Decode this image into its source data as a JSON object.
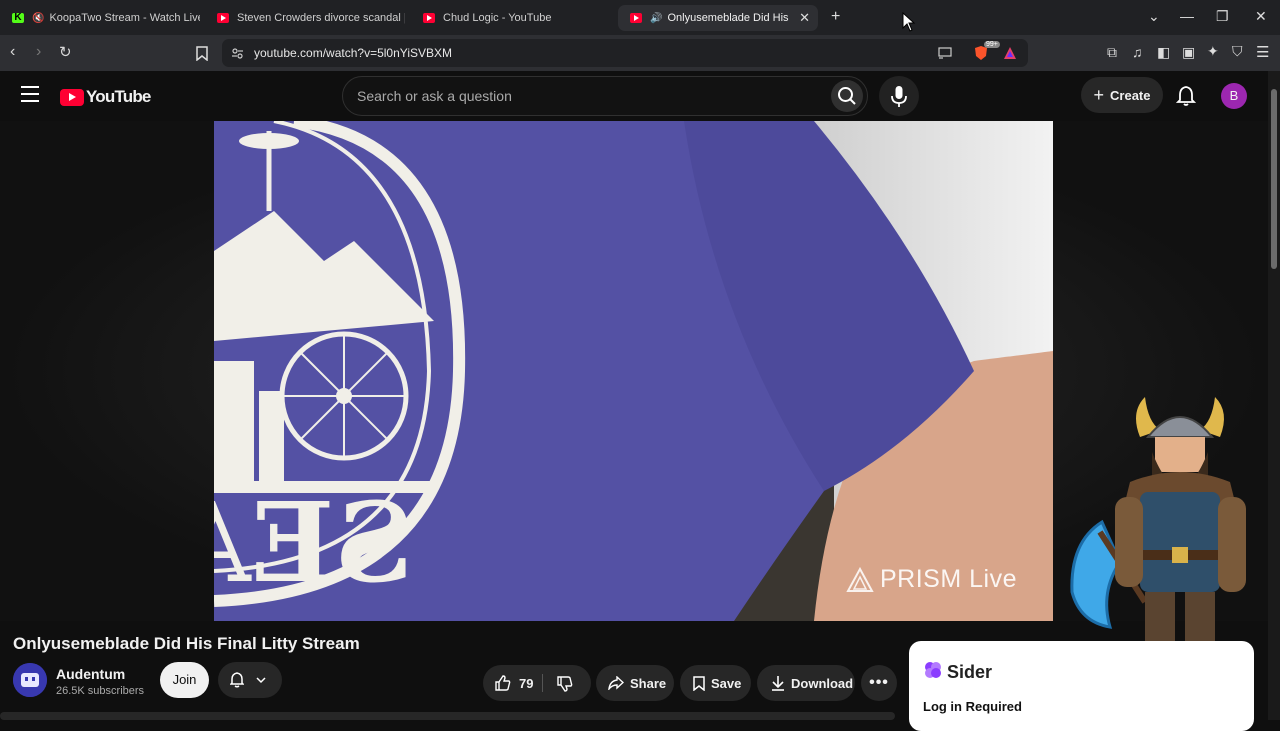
{
  "browser": {
    "tabs": [
      {
        "title": "KoopaTwo Stream - Watch Live o",
        "favicon": "kick-icon",
        "muted": true
      },
      {
        "title": "Steven Crowders divorce scandal | RE",
        "favicon": "youtube-icon"
      },
      {
        "title": "Chud Logic - YouTube",
        "favicon": "youtube-icon"
      },
      {
        "title": "Onlyusemeblade Did His Fina",
        "favicon": "youtube-icon",
        "playing": true,
        "active": true
      }
    ],
    "new_tab": "+",
    "url": "youtube.com/watch?v=5l0nYiSVBXM",
    "extension_badge": "99+"
  },
  "youtube": {
    "logo_text": "YouTube",
    "search_placeholder": "Search or ask a question",
    "create_label": "Create",
    "avatar_letter": "B"
  },
  "video": {
    "watermark": "PRISM Live",
    "title": "Onlyusemeblade Did His Final Litty Stream",
    "shirt_text": "SEA"
  },
  "channel": {
    "name": "Audentum",
    "subscribers": "26.5K subscribers",
    "join_label": "Join"
  },
  "actions": {
    "likes": "79",
    "share_label": "Share",
    "save_label": "Save",
    "download_label": "Download"
  },
  "sider": {
    "name": "Sider",
    "message": "Log in Required"
  },
  "colors": {
    "youtube_red": "#ff0033",
    "sider_purple": "#8b3dff",
    "avatar_purple": "#9c27b0"
  }
}
